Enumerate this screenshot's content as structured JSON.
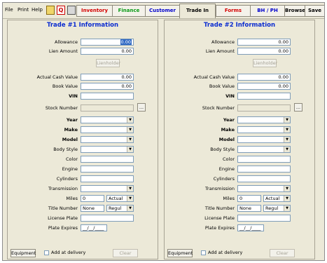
{
  "menu": {
    "file": "File",
    "print": "Print",
    "help": "Help"
  },
  "tabs": [
    {
      "label": "Inventory",
      "color": "#d40000"
    },
    {
      "label": "Finance",
      "color": "#0a9a16"
    },
    {
      "label": "Customer",
      "color": "#0000cc"
    },
    {
      "label": "Trade In",
      "color": "#000000"
    },
    {
      "label": "Forms",
      "color": "#d40000"
    },
    {
      "label": "BH / PH",
      "color": "#0000cc"
    },
    {
      "label": "Browse",
      "color": "#000000"
    },
    {
      "label": "Save",
      "color": "#000000"
    }
  ],
  "labels": {
    "allowance": "Allowance",
    "lien_amount": "Lien Amount",
    "lienholder": "Lienholder",
    "actual_cash_value": "Actual Cash Value",
    "book_value": "Book Value",
    "vin": "VIN",
    "stock_number": "Stock Number",
    "year": "Year",
    "make": "Make",
    "model": "Model",
    "body_style": "Body Style",
    "color": "Color",
    "engine": "Engine",
    "cylinders": "Cylinders",
    "transmission": "Transmission",
    "miles": "Miles",
    "title_number": "Title Number",
    "license_plate": "License Plate",
    "plate_expires": "Plate Expires",
    "equipment": "Equipment",
    "add_at_delivery": "Add at delivery",
    "clear": "Clear",
    "browse_btn": "..."
  },
  "trade1": {
    "title": "Trade #1 Information",
    "allowance_selected": "0.00",
    "lien_amount": "0.00",
    "actual_cash_value": "0.00",
    "book_value": "0.00",
    "miles": "0",
    "miles_type": "Actual",
    "title_number": "None",
    "title_type": "Regul",
    "plate_expires": "__/__/____"
  },
  "trade2": {
    "title": "Trade #2 Information",
    "allowance": "0.00",
    "lien_amount": "0.00",
    "actual_cash_value": "0.00",
    "book_value": "0.00",
    "miles": "0",
    "miles_type": "Actual",
    "title_number": "None",
    "title_type": "Regul",
    "plate_expires": "__/__/____"
  }
}
